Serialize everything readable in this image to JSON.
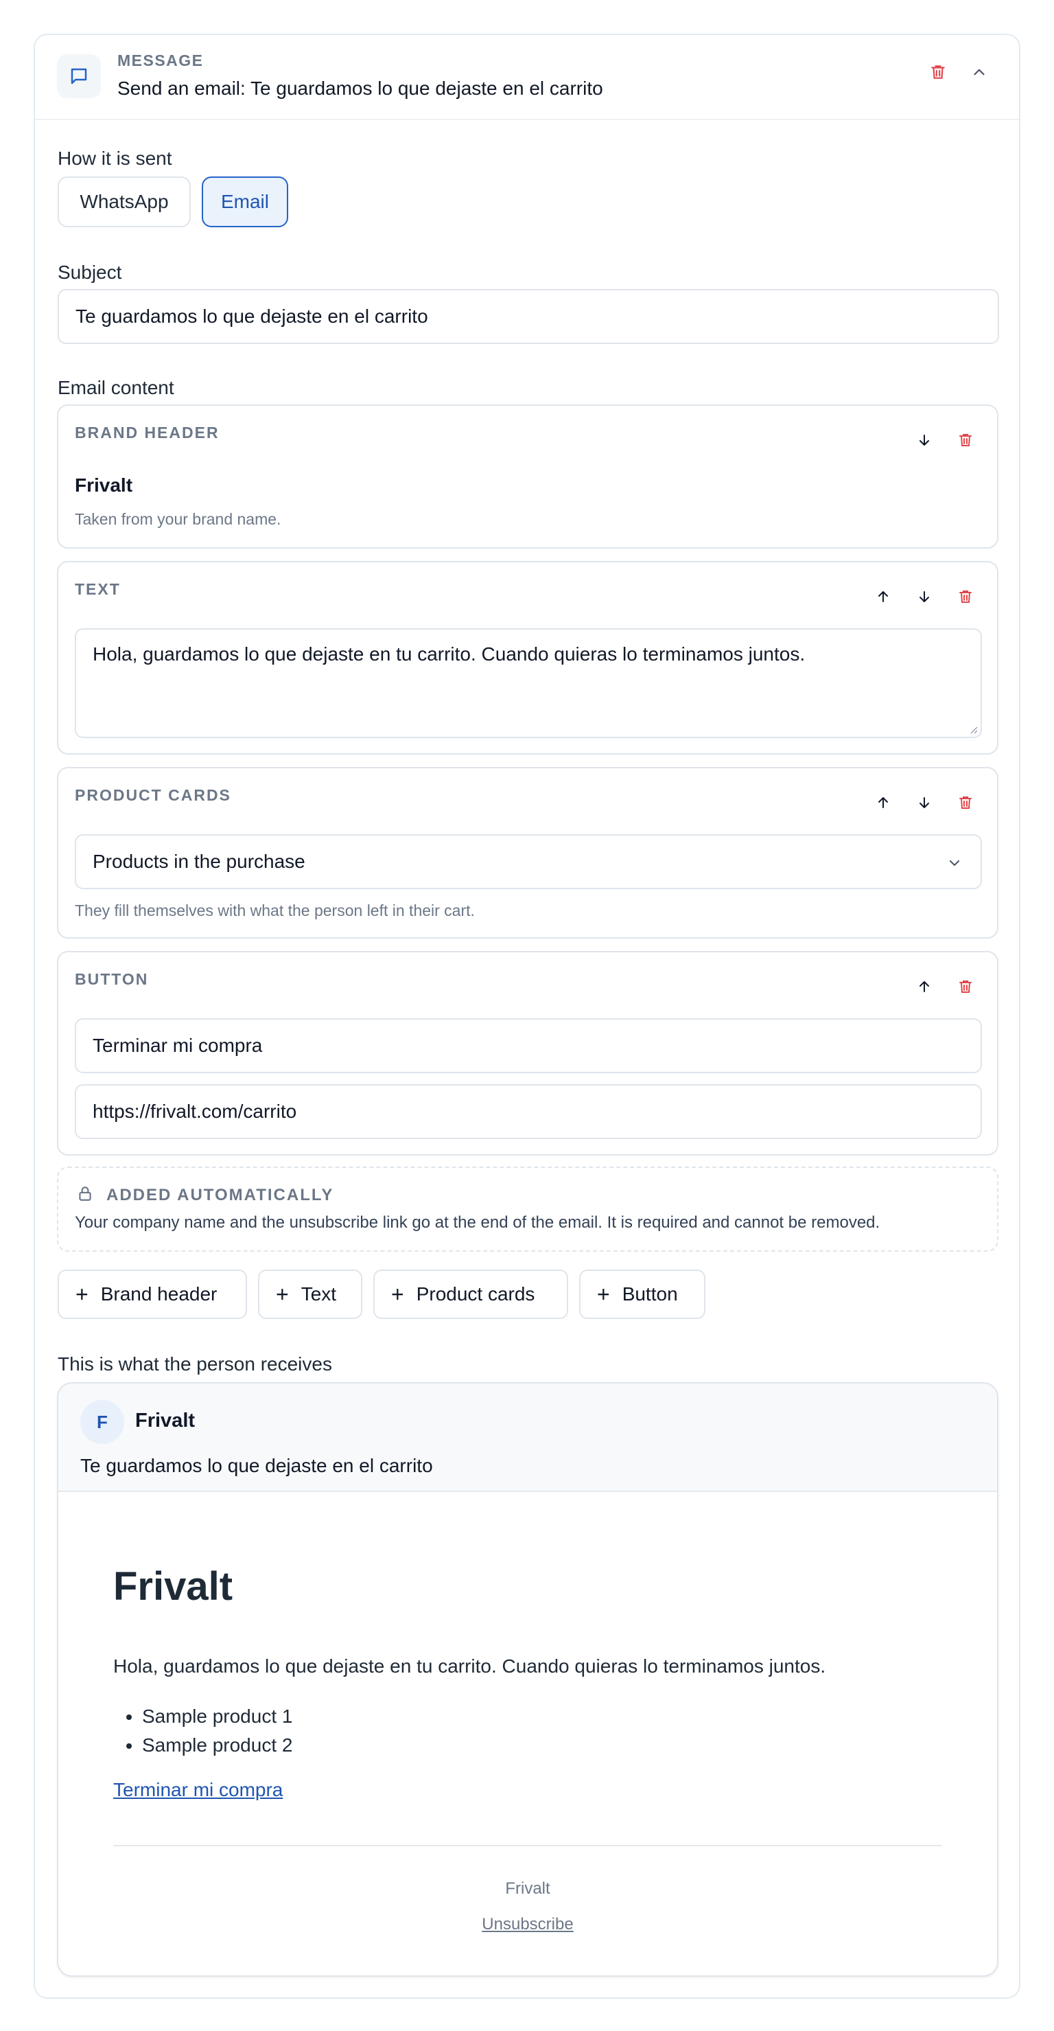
{
  "header": {
    "kicker": "MESSAGE",
    "title": "Send an email: Te guardamos lo que dejaste en el carrito",
    "icon": "message-square-icon"
  },
  "channel": {
    "label": "How it is sent",
    "options": [
      "WhatsApp",
      "Email"
    ],
    "selected": "Email"
  },
  "subject": {
    "label": "Subject",
    "value": "Te guardamos lo que dejaste en el carrito"
  },
  "content": {
    "label": "Email content",
    "brand_header": {
      "title": "BRAND HEADER",
      "name": "Frivalt",
      "help": "Taken from your brand name."
    },
    "text_block": {
      "title": "TEXT",
      "value": "Hola, guardamos lo que dejaste en tu carrito. Cuando quieras lo terminamos juntos."
    },
    "product_cards": {
      "title": "PRODUCT CARDS",
      "selected": "Products in the purchase",
      "help": "They fill themselves with what the person left in their cart."
    },
    "button_block": {
      "title": "BUTTON",
      "label_value": "Terminar mi compra",
      "url_value": "https://frivalt.com/carrito"
    },
    "auto": {
      "title": "ADDED AUTOMATICALLY",
      "text": "Your company name and the unsubscribe link go at the end of the email. It is required and cannot be removed."
    }
  },
  "add_buttons": [
    "Brand header",
    "Text",
    "Product cards",
    "Button"
  ],
  "preview": {
    "label": "This is what the person receives",
    "avatar_letter": "F",
    "sender": "Frivalt",
    "subject": "Te guardamos lo que dejaste en el carrito",
    "brand": "Frivalt",
    "text": "Hola, guardamos lo que dejaste en tu carrito. Cuando quieras lo terminamos juntos.",
    "products": [
      "Sample product 1",
      "Sample product 2"
    ],
    "button_link": "Terminar mi compra",
    "footer_company": "Frivalt",
    "unsubscribe": "Unsubscribe"
  },
  "colors": {
    "accent": "#1f55b0",
    "danger": "#e0474c",
    "muted": "#6b7787",
    "border": "#dfe5eb"
  }
}
